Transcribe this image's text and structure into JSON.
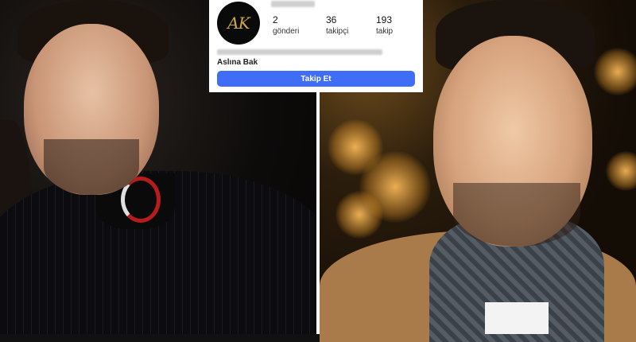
{
  "profile": {
    "avatar_monogram": "AK",
    "stats": [
      {
        "value": "2",
        "label": "gönderi"
      },
      {
        "value": "36",
        "label": "takipçi"
      },
      {
        "value": "193",
        "label": "takip"
      }
    ],
    "bio_link": "Aslına Bak",
    "follow_button": "Takip Et",
    "button_color": "#3f6df5"
  }
}
